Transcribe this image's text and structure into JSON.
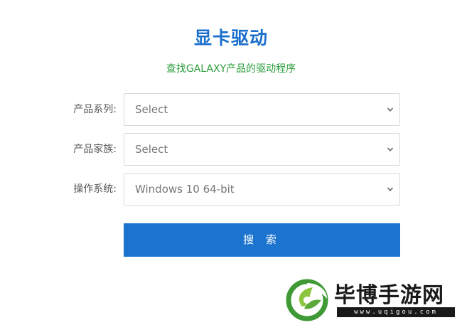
{
  "header": {
    "title": "显卡驱动",
    "subtitle": "查找GALAXY产品的驱动程序"
  },
  "form": {
    "fields": [
      {
        "label": "产品系列:",
        "value": "Select"
      },
      {
        "label": "产品家族:",
        "value": "Select"
      },
      {
        "label": "操作系统:",
        "value": "Windows 10 64-bit"
      }
    ],
    "search_label": "搜 索"
  },
  "watermark": {
    "name": "毕博手游网",
    "url": "www.uqigou.com"
  },
  "colors": {
    "title": "#1b6fcc",
    "subtitle": "#2a9d3a",
    "button": "#1c74cf",
    "border": "#d9d9d9"
  },
  "icons": {
    "dropdown": "chevron-down-icon",
    "logo": "leaf-logo-icon"
  }
}
